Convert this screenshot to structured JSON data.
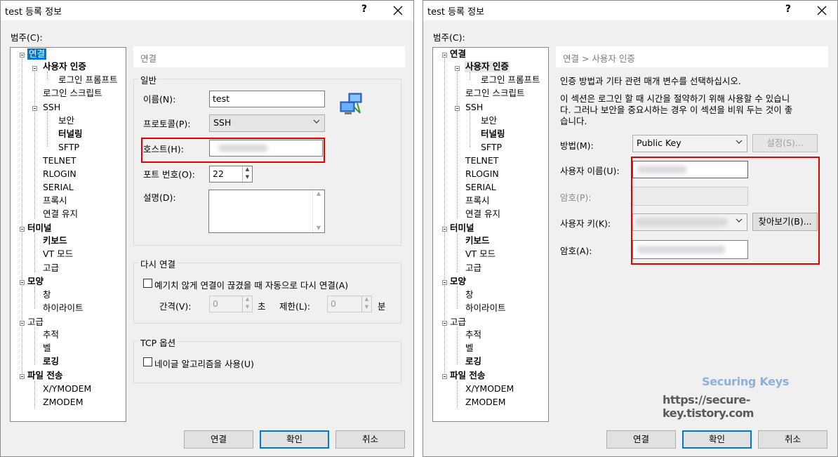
{
  "left": {
    "title": "test 등록 정보",
    "help": "?",
    "category_label": "범주(C):",
    "tree": [
      "연결",
      "사용자 인증",
      "로그인 프롬프트",
      "로그인 스크립트",
      "SSH",
      "보안",
      "터널링",
      "SFTP",
      "TELNET",
      "RLOGIN",
      "SERIAL",
      "프록시",
      "연결 유지",
      "터미널",
      "키보드",
      "VT 모드",
      "고급",
      "모양",
      "창",
      "하이라이트",
      "고급",
      "추적",
      "벨",
      "로깅",
      "파일 전송",
      "X/YMODEM",
      "ZMODEM"
    ],
    "header": "연결",
    "general_group": "일반",
    "name_label": "이름(N):",
    "name_value": "test",
    "protocol_label": "프로토콜(P):",
    "protocol_value": "SSH",
    "host_label": "호스트(H):",
    "port_label": "포트 번호(O):",
    "port_value": "22",
    "desc_label": "설명(D):",
    "reconnect_group": "다시 연결",
    "reconnect_check": "예기치 않게 연결이 끊겼을 때 자동으로 다시 연결(A)",
    "interval_label": "간격(V):",
    "interval_value": "0",
    "interval_unit": "초",
    "limit_label": "제한(L):",
    "limit_value": "0",
    "limit_unit": "분",
    "tcp_group": "TCP 옵션",
    "nagle_check": "네이글 알고리즘을 사용(U)",
    "connect_btn": "연결",
    "ok_btn": "확인",
    "cancel_btn": "취소"
  },
  "right": {
    "title": "test 등록 정보",
    "help": "?",
    "category_label": "범주(C):",
    "tree": [
      "연결",
      "사용자 인증",
      "로그인 프롬프트",
      "로그인 스크립트",
      "SSH",
      "보안",
      "터널링",
      "SFTP",
      "TELNET",
      "RLOGIN",
      "SERIAL",
      "프록시",
      "연결 유지",
      "터미널",
      "키보드",
      "VT 모드",
      "고급",
      "모양",
      "창",
      "하이라이트",
      "고급",
      "추적",
      "벨",
      "로깅",
      "파일 전송",
      "X/YMODEM",
      "ZMODEM"
    ],
    "header": "연결 > 사용자 인증",
    "desc1": "인증 방법과 기타 관련 매개 변수를 선택하십시오.",
    "desc2": "이 섹션은 로그인 할 때 시간을 절약하기 위해 사용할 수 있습니",
    "desc3": "다. 그러나 보안을 중요시하는 경우 이 섹션을 비워 두는 것이 좋",
    "desc4": "습니다.",
    "method_label": "방법(M):",
    "method_value": "Public Key",
    "settings_btn": "설정(S)...",
    "username_label": "사용자 이름(U):",
    "password_label": "암호(P):",
    "userkey_label": "사용자 키(K):",
    "browse_btn": "찾아보기(B)...",
    "passphrase_label": "암호(A):",
    "connect_btn": "연결",
    "ok_btn": "확인",
    "cancel_btn": "취소"
  },
  "watermark": {
    "line1": "Securing Keys",
    "line2": "https://secure-key.tistory.com"
  },
  "colors": {
    "highlight": "#e00000",
    "selection": "#0078d7"
  }
}
